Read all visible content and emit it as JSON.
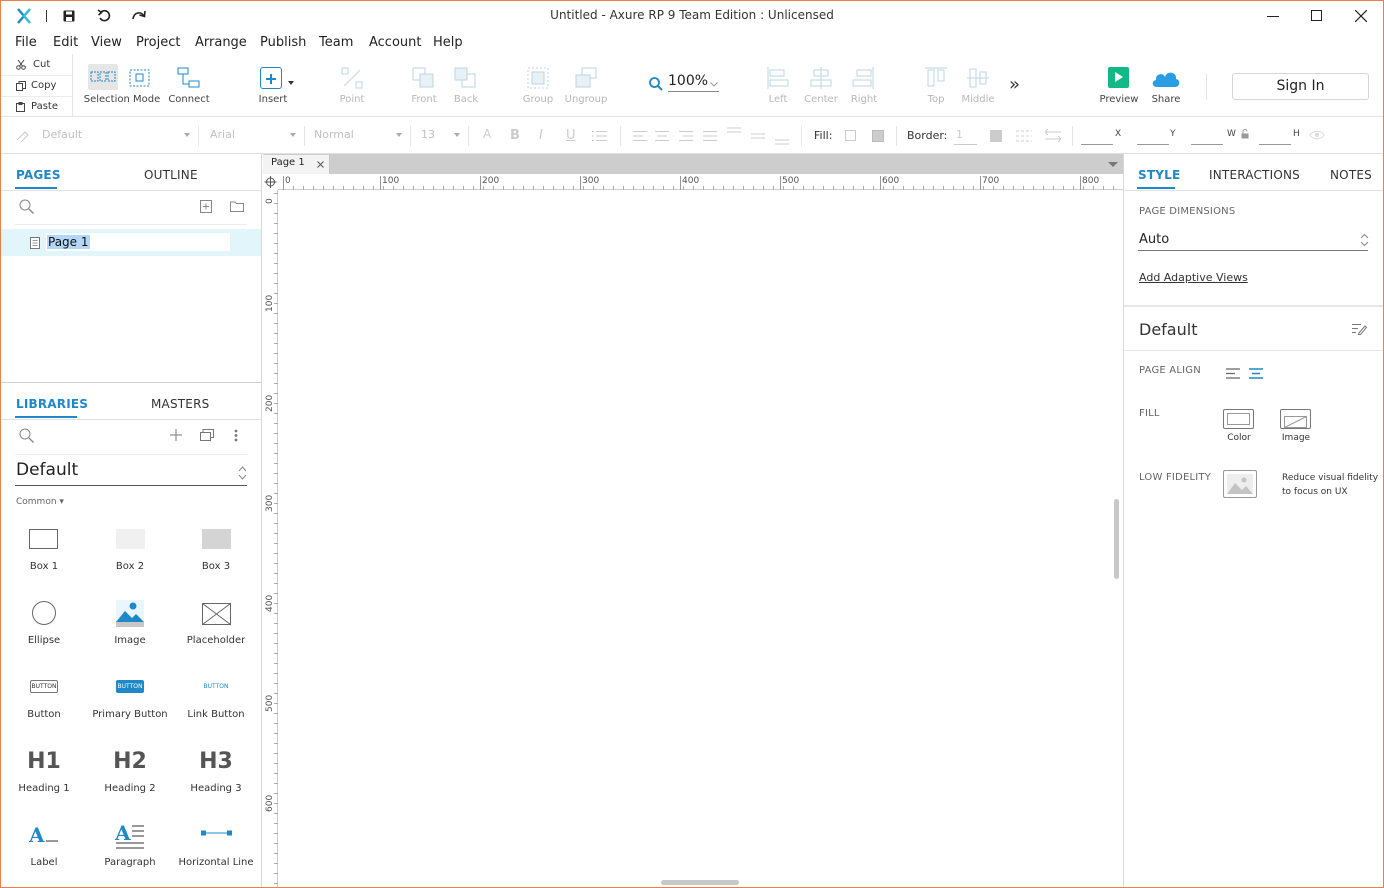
{
  "window": {
    "title": "Untitled - Axure RP 9 Team Edition : Unlicensed"
  },
  "menu": [
    "File",
    "Edit",
    "View",
    "Project",
    "Arrange",
    "Publish",
    "Team",
    "Account",
    "Help"
  ],
  "clipboard": {
    "cut": "Cut",
    "copy": "Copy",
    "paste": "Paste"
  },
  "toolbar": {
    "selection_mode": "Selection Mode",
    "connect": "Connect",
    "insert": "Insert",
    "point": "Point",
    "front": "Front",
    "back": "Back",
    "group": "Group",
    "ungroup": "Ungroup",
    "zoom": "100%",
    "left": "Left",
    "center": "Center",
    "right": "Right",
    "top": "Top",
    "middle": "Middle",
    "more": "»",
    "preview": "Preview",
    "share": "Share",
    "sign_in": "Sign In"
  },
  "format": {
    "style": "Default",
    "font": "Arial",
    "weight": "Normal",
    "size": "13",
    "fill_label": "Fill:",
    "border_label": "Border:",
    "border_value": "1",
    "x": "X",
    "y": "Y",
    "w": "W",
    "h": "H"
  },
  "pages_panel": {
    "tab_pages": "PAGES",
    "tab_outline": "OUTLINE",
    "pages": [
      "Page 1"
    ]
  },
  "libraries_panel": {
    "tab_libraries": "LIBRARIES",
    "tab_masters": "MASTERS",
    "library": "Default",
    "group": "Common ▾",
    "widgets": [
      {
        "label": "Box 1"
      },
      {
        "label": "Box 2"
      },
      {
        "label": "Box 3"
      },
      {
        "label": "Ellipse"
      },
      {
        "label": "Image"
      },
      {
        "label": "Placeholder"
      },
      {
        "label": "Button"
      },
      {
        "label": "Primary Button"
      },
      {
        "label": "Link Button"
      },
      {
        "label": "Heading 1"
      },
      {
        "label": "Heading 2"
      },
      {
        "label": "Heading 3"
      },
      {
        "label": "Label"
      },
      {
        "label": "Paragraph"
      },
      {
        "label": "Horizontal Line"
      }
    ],
    "button_text": "BUTTON",
    "h1": "H1",
    "h2": "H2",
    "h3": "H3"
  },
  "canvas": {
    "tab": "Page 1",
    "hruler": [
      "0",
      "100",
      "200",
      "300",
      "400",
      "500",
      "600",
      "700",
      "800"
    ],
    "vruler": [
      "0",
      "100",
      "200",
      "300",
      "400",
      "500",
      "600"
    ]
  },
  "right_panel": {
    "tab_style": "STYLE",
    "tab_interactions": "INTERACTIONS",
    "tab_notes": "NOTES",
    "page_dimensions_label": "PAGE DIMENSIONS",
    "page_dimensions_value": "Auto",
    "add_adaptive": "Add Adaptive Views",
    "style_name": "Default",
    "page_align_label": "PAGE ALIGN",
    "fill_label": "FILL",
    "fill_color": "Color",
    "fill_image": "Image",
    "low_fidelity_label": "LOW FIDELITY",
    "low_fidelity_desc_1": "Reduce visual fidelity",
    "low_fidelity_desc_2": "to focus on UX"
  },
  "colors": {
    "accent": "#1e88c8",
    "window_border": "#e8824a",
    "preview": "#12b886"
  }
}
